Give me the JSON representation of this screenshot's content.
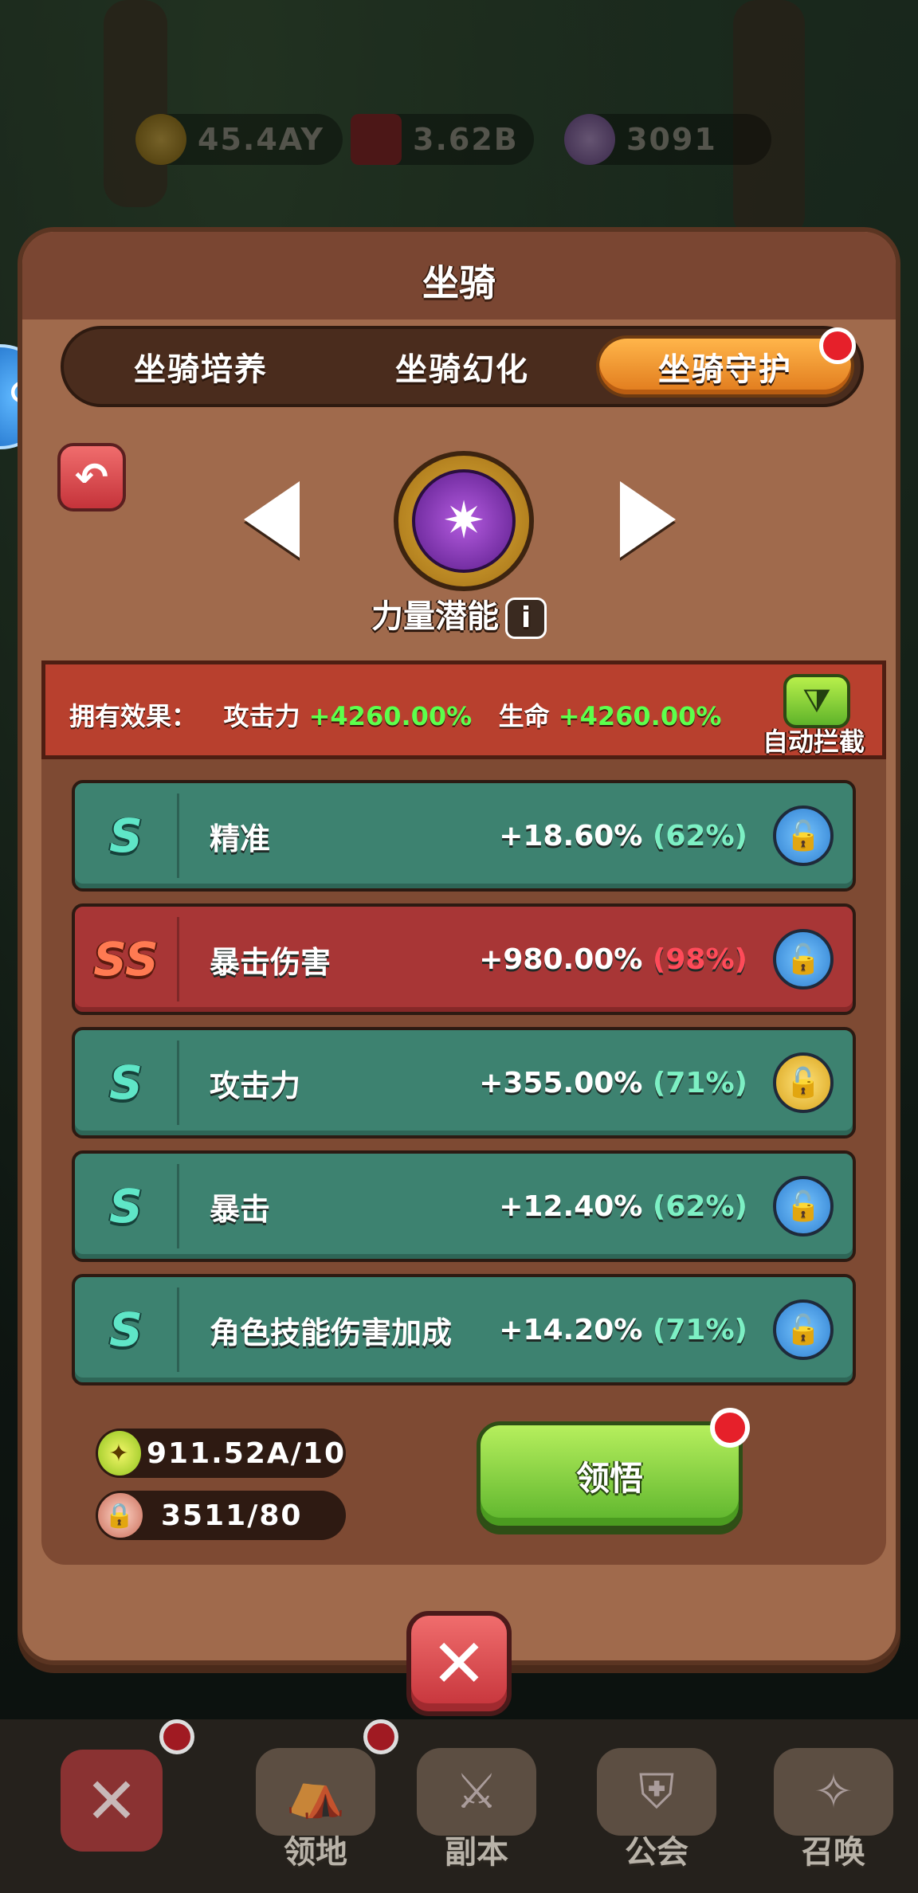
{
  "currency": {
    "gold": "45.4AY",
    "ruby": "3.62B",
    "gems": "3091"
  },
  "dialog": {
    "title": "坐骑",
    "tabs": [
      {
        "label": "坐骑培养",
        "active": false
      },
      {
        "label": "坐骑幻化",
        "active": false
      },
      {
        "label": "坐骑守护",
        "active": true
      }
    ],
    "emblem_name": "力量潜能",
    "info_icon": "i",
    "effect": {
      "label": "拥有效果：",
      "attack_label": "攻击力",
      "attack_value": "+4260.00%",
      "hp_label": "生命",
      "hp_value": "+4260.00%"
    },
    "auto_intercept_label": "自动拦截",
    "stats": [
      {
        "grade": "S",
        "name": "精准",
        "value": "+18.60%",
        "pct": "(62%)",
        "lock": "blue"
      },
      {
        "grade": "SS",
        "name": "暴击伤害",
        "value": "+980.00%",
        "pct": "(98%)",
        "lock": "blue"
      },
      {
        "grade": "S",
        "name": "攻击力",
        "value": "+355.00%",
        "pct": "(71%)",
        "lock": "gold"
      },
      {
        "grade": "S",
        "name": "暴击",
        "value": "+12.40%",
        "pct": "(62%)",
        "lock": "blue"
      },
      {
        "grade": "S",
        "name": "角色技能伤害加成",
        "value": "+14.20%",
        "pct": "(71%)",
        "lock": "blue"
      }
    ],
    "resources": {
      "essence": "911.52A/10",
      "lock_count": "3511/80"
    },
    "awaken_button": "领悟"
  },
  "bottom_nav": {
    "items": [
      "领地",
      "副本",
      "公会",
      "召唤"
    ]
  },
  "colors": {
    "accent_orange": "#e07a1c",
    "teal_row": "#3d8270",
    "red_row": "#a83636",
    "effect_green": "#5dff4c"
  }
}
